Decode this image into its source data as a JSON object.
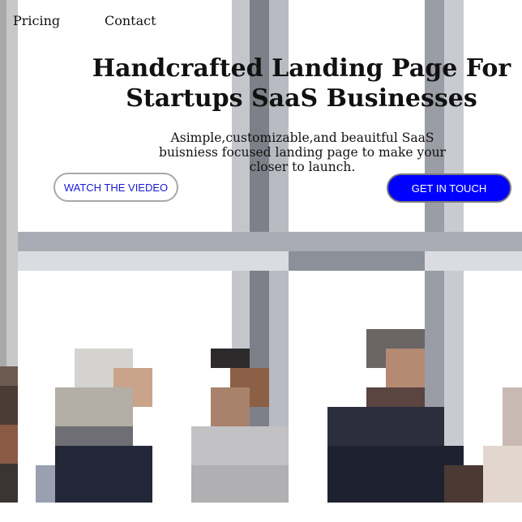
{
  "nav": {
    "pricing": "Pricing",
    "contact": "Contact"
  },
  "hero": {
    "title": "Handcrafted Landing Page For Startups SaaS Businesses",
    "subtitle": "Asimple,customizable,and beauitful SaaS buisniess focused landing page to make your closer to launch."
  },
  "buttons": {
    "watch": "WATCH THE VIEDEO",
    "contact": "GET IN TOUCH"
  },
  "colors": {
    "primary_button": "#0000ff",
    "link_text": "#1a1ad4",
    "text": "#111111"
  }
}
